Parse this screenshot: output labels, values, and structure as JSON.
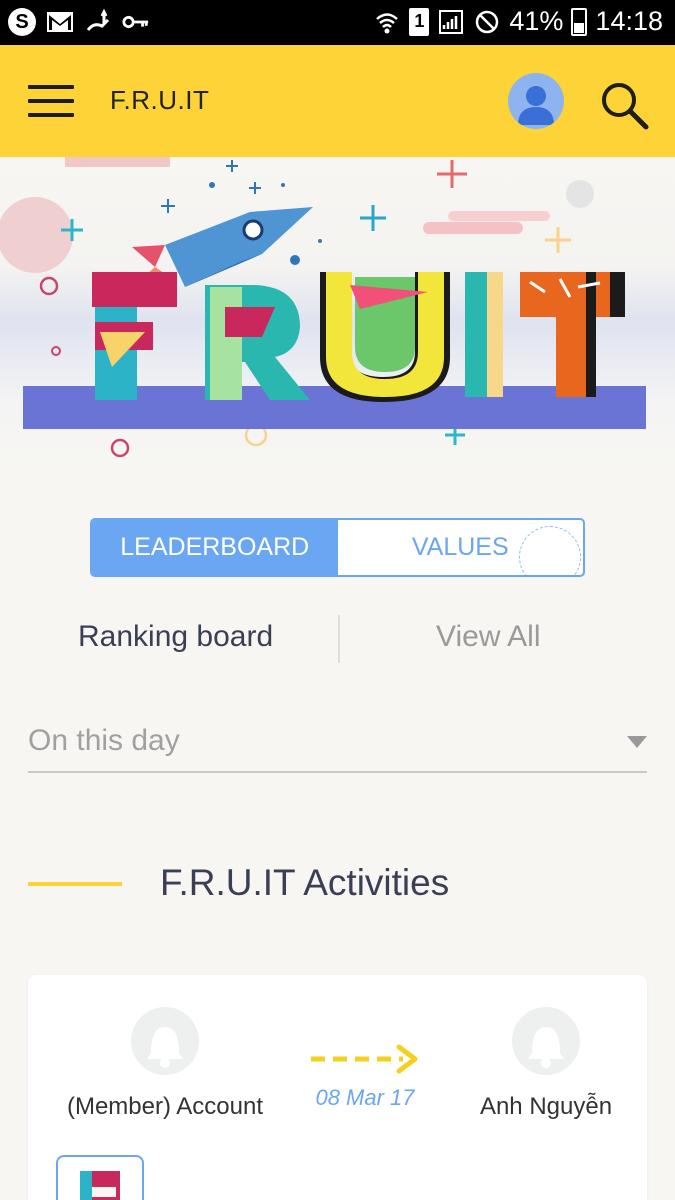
{
  "status_bar": {
    "battery": "41%",
    "time": "14:18",
    "sim_slot": "1",
    "left_icons": [
      "skype-icon",
      "gmail-icon",
      "usb-icon",
      "vpn-key-icon"
    ],
    "right_icons": [
      "wifi-icon",
      "sim-icon",
      "signal-icon",
      "blocked-icon",
      "battery-icon"
    ]
  },
  "app_bar": {
    "title": "F.R.U.IT",
    "menu_icon": "hamburger-icon",
    "avatar_icon": "user-avatar",
    "search_icon": "search-icon",
    "background": "#fdd337"
  },
  "banner": {
    "logo_text": "FRUIT",
    "logo_letters": [
      "F",
      "R",
      "U",
      "I",
      "T"
    ]
  },
  "tabs": {
    "items": [
      {
        "label": "LEADERBOARD",
        "active": true
      },
      {
        "label": "VALUES",
        "active": false
      }
    ],
    "accent": "#6ba6f2"
  },
  "ranking": {
    "title": "Ranking board",
    "view_all": "View All"
  },
  "filter": {
    "selected": "On this day"
  },
  "activities": {
    "title": "F.R.U.IT Activities",
    "card": {
      "from_name": "(Member) Account",
      "to_name": "Anh Nguyễn",
      "date": "08 Mar 17"
    }
  }
}
